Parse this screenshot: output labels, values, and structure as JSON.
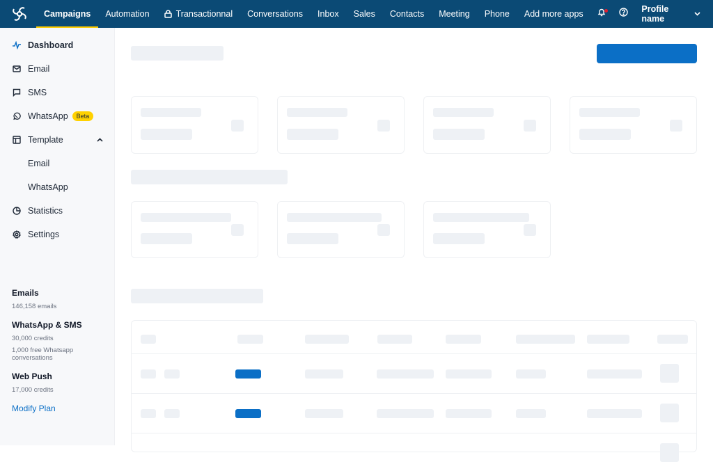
{
  "topbar": {
    "brand_icon": "brevo-logo-icon",
    "nav": [
      {
        "label": "Campaigns",
        "active": true
      },
      {
        "label": "Automation"
      },
      {
        "label": "Transactionnal",
        "icon": "lock-icon"
      },
      {
        "label": "Conversations"
      },
      {
        "label": "Inbox"
      },
      {
        "label": "Sales"
      },
      {
        "label": "Contacts"
      },
      {
        "label": "Meeting"
      },
      {
        "label": "Phone"
      },
      {
        "label": "Add more apps"
      }
    ],
    "notification_icon": "bell-icon",
    "help_icon": "help-circle-icon",
    "profile_name": "Profile name",
    "colors": {
      "bar": "#0b4a75",
      "active_underline": "#ffcd00",
      "notification_dot": "#e11d2e"
    }
  },
  "sidebar": {
    "items": [
      {
        "label": "Dashboard",
        "icon": "activity-icon",
        "active": true
      },
      {
        "label": "Email",
        "icon": "mail-icon"
      },
      {
        "label": "SMS",
        "icon": "message-square-icon"
      },
      {
        "label": "WhatsApp",
        "icon": "whatsapp-icon",
        "badge": "Beta"
      },
      {
        "label": "Template",
        "icon": "layout-template-icon",
        "expanded": true
      },
      {
        "label": "Email",
        "sub": true
      },
      {
        "label": "WhatsApp",
        "sub": true
      },
      {
        "label": "Statistics",
        "icon": "pie-chart-icon"
      },
      {
        "label": "Settings",
        "icon": "settings-gear-icon"
      }
    ],
    "plan": [
      {
        "title": "Emails",
        "lines": [
          "146,158 emails"
        ]
      },
      {
        "title": "WhatsApp & SMS",
        "lines": [
          "30,000 credits",
          "1,000 free Whatsapp conversations"
        ]
      },
      {
        "title": "Web Push",
        "lines": [
          "17,000 credits"
        ]
      }
    ],
    "modify_plan": "Modify Plan",
    "colors": {
      "accent": "#0b6fc6",
      "badge": "#ffd100"
    }
  },
  "main": {
    "state": "loading-skeleton",
    "colors": {
      "skeleton": "#eef1f5",
      "primary": "#0b6fc6"
    }
  }
}
